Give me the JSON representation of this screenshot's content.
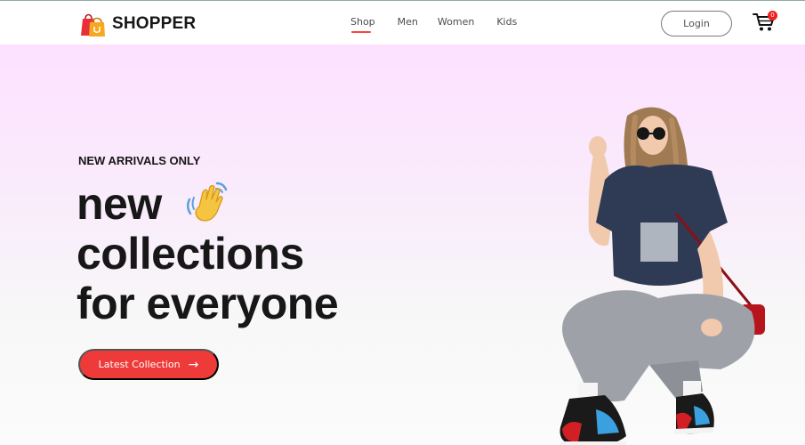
{
  "brand": {
    "name": "SHOPPER",
    "logo_icon": "shopping-bag-icon"
  },
  "nav": {
    "items": [
      {
        "label": "Shop",
        "active": true
      },
      {
        "label": "Men",
        "active": false
      },
      {
        "label": "Women",
        "active": false
      },
      {
        "label": "Kids",
        "active": false
      }
    ],
    "login_label": "Login",
    "cart_icon": "shopping-cart-icon",
    "cart_count": "0"
  },
  "hero": {
    "eyebrow": "NEW ARRIVALS ONLY",
    "line1": "new",
    "line2": "collections",
    "line3": "for everyone",
    "wave_icon": "waving-hand-icon",
    "cta_label": "Latest Collection",
    "cta_icon": "arrow-right-icon",
    "image": "woman-in-sneakers-photo"
  },
  "colors": {
    "accent": "#ff4141",
    "cta_bg": "#ef3a3a",
    "text": "#171717",
    "hero_gradient_top": "#fde1ff",
    "hero_gradient_bottom": "#fafbfa"
  }
}
